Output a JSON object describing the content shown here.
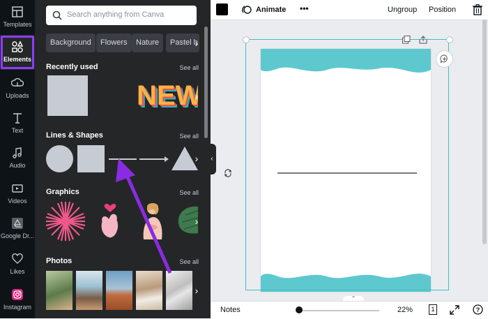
{
  "sidebar": {
    "items": [
      {
        "label": "Templates",
        "icon": "templates-icon"
      },
      {
        "label": "Elements",
        "icon": "elements-icon",
        "active": true
      },
      {
        "label": "Uploads",
        "icon": "uploads-icon"
      },
      {
        "label": "Text",
        "icon": "text-icon"
      },
      {
        "label": "Audio",
        "icon": "audio-icon"
      },
      {
        "label": "Videos",
        "icon": "videos-icon"
      },
      {
        "label": "Google Dr...",
        "icon": "google-drive-icon"
      },
      {
        "label": "Likes",
        "icon": "heart-icon"
      },
      {
        "label": "Instagram",
        "icon": "instagram-icon"
      }
    ]
  },
  "panel": {
    "search_placeholder": "Search anything from Canva",
    "chips": [
      "Background",
      "Flowers",
      "Nature",
      "Pastel b"
    ],
    "sections": {
      "recently_used": {
        "title": "Recently used",
        "see_all": "See all"
      },
      "lines_shapes": {
        "title": "Lines & Shapes",
        "see_all": "See all"
      },
      "graphics": {
        "title": "Graphics",
        "see_all": "See all"
      },
      "photos": {
        "title": "Photos",
        "see_all": "See all"
      }
    },
    "new_graphic_text": "NEW"
  },
  "topbar": {
    "animate_label": "Animate",
    "more_label": "•••",
    "ungroup_label": "Ungroup",
    "position_label": "Position"
  },
  "bottombar": {
    "notes_label": "Notes",
    "zoom_label": "22%",
    "page_count": "1",
    "zoom_value": 0.22
  },
  "colors": {
    "accent": "#8b3dff",
    "rail_bg": "#0e1318",
    "panel_bg": "#252627",
    "wave": "#5ec8cf",
    "selection": "#3fbec3"
  }
}
